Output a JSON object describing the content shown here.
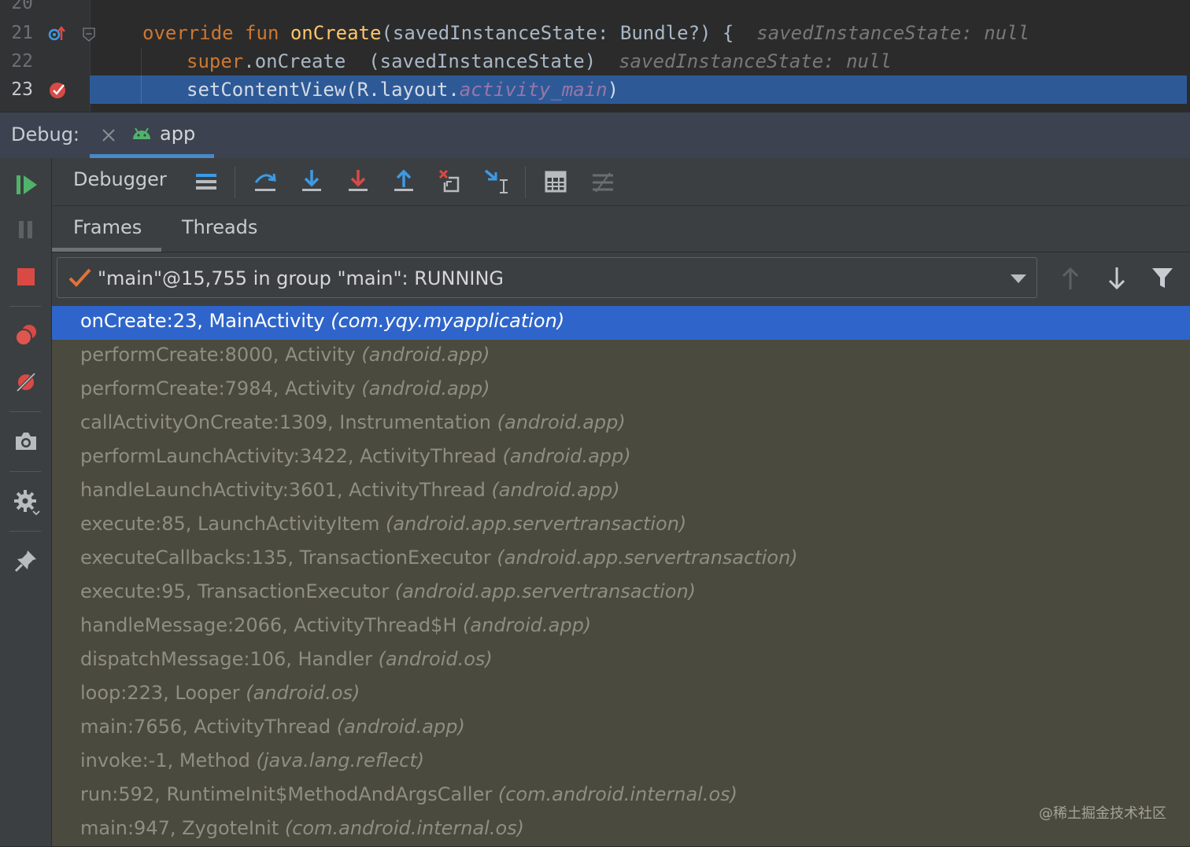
{
  "editor": {
    "lines": [
      {
        "number": "20"
      },
      {
        "number": "21",
        "kw1": "override",
        "kw2": "fun",
        "name": "onCreate",
        "params": "(savedInstanceState: Bundle?) {",
        "hint": "savedInstanceState: null"
      },
      {
        "number": "22",
        "kw": "super",
        "call": ".onCreate",
        "args": "(savedInstanceState)",
        "hint": "savedInstanceState: null"
      },
      {
        "number": "23",
        "pre": "setContentView(R.layout.",
        "field": "activity_main",
        "post": ")"
      }
    ]
  },
  "debug_panel": {
    "label": "Debug:",
    "tab": "app",
    "toolbar_title": "Debugger",
    "subtabs": [
      "Frames",
      "Threads"
    ],
    "thread_selector": "\"main\"@15,755 in group \"main\": RUNNING"
  },
  "frames": [
    {
      "method": "onCreate:23, MainActivity ",
      "pkg": "(com.yqy.myapplication)"
    },
    {
      "method": "performCreate:8000, Activity ",
      "pkg": "(android.app)"
    },
    {
      "method": "performCreate:7984, Activity ",
      "pkg": "(android.app)"
    },
    {
      "method": "callActivityOnCreate:1309, Instrumentation ",
      "pkg": "(android.app)"
    },
    {
      "method": "performLaunchActivity:3422, ActivityThread ",
      "pkg": "(android.app)"
    },
    {
      "method": "handleLaunchActivity:3601, ActivityThread ",
      "pkg": "(android.app)"
    },
    {
      "method": "execute:85, LaunchActivityItem ",
      "pkg": "(android.app.servertransaction)"
    },
    {
      "method": "executeCallbacks:135, TransactionExecutor ",
      "pkg": "(android.app.servertransaction)"
    },
    {
      "method": "execute:95, TransactionExecutor ",
      "pkg": "(android.app.servertransaction)"
    },
    {
      "method": "handleMessage:2066, ActivityThread$H ",
      "pkg": "(android.app)"
    },
    {
      "method": "dispatchMessage:106, Handler ",
      "pkg": "(android.os)"
    },
    {
      "method": "loop:223, Looper ",
      "pkg": "(android.os)"
    },
    {
      "method": "main:7656, ActivityThread ",
      "pkg": "(android.app)"
    },
    {
      "method": "invoke:-1, Method ",
      "pkg": "(java.lang.reflect)"
    },
    {
      "method": "run:592, RuntimeInit$MethodAndArgsCaller ",
      "pkg": "(com.android.internal.os)"
    },
    {
      "method": "main:947, ZygoteInit ",
      "pkg": "(com.android.internal.os)"
    }
  ],
  "watermark": "@稀土掘金技术社区",
  "colors": {
    "selection": "#2f65ca",
    "frames_bg": "#4b4a3e",
    "resume_green": "#4fb36b",
    "step_blue": "#3d9ae5",
    "stop_red": "#d94a45"
  }
}
